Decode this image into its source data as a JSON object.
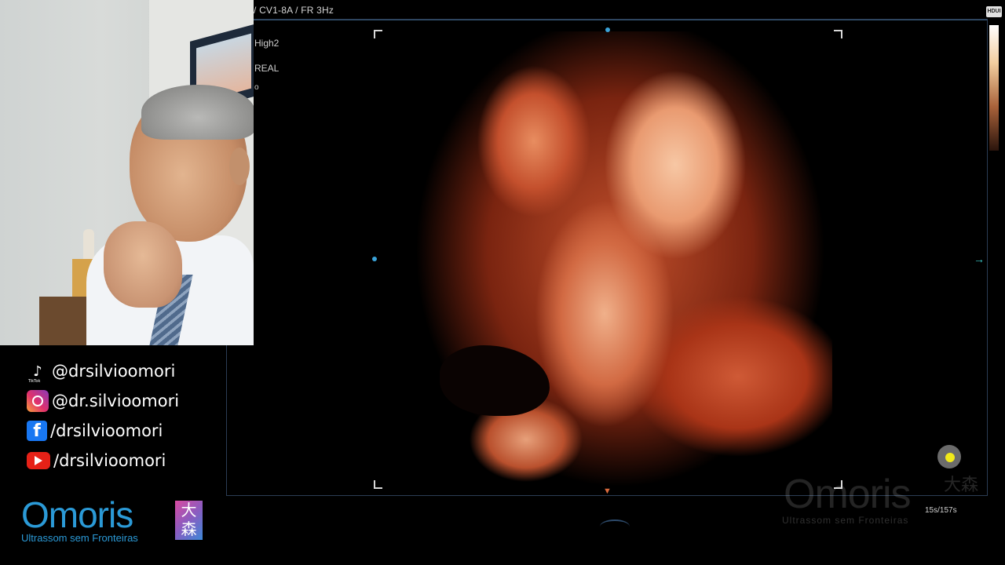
{
  "ultrasound": {
    "probe_info": "/ CV1-8A / FR 3Hz",
    "param_1": "High2",
    "param_2": "REAL",
    "param_3": "o",
    "badge": "HDUI",
    "timer": "15s/157s"
  },
  "watermark": {
    "logo": "Omoris",
    "tagline": "Ultrassom sem Fronteiras",
    "kanji": "大森"
  },
  "social": [
    {
      "platform": "TikTok",
      "icon": "tiktok-icon",
      "handle": "@drsilvioomori",
      "icon_caption": "TikTok"
    },
    {
      "platform": "Instagram",
      "icon": "instagram-icon",
      "handle": "@dr.silvioomori"
    },
    {
      "platform": "Facebook",
      "icon": "facebook-icon",
      "handle": "/drsilvioomori",
      "glyph": "f"
    },
    {
      "platform": "YouTube",
      "icon": "youtube-icon",
      "handle": "/drsilvioomori"
    }
  ],
  "brand": {
    "name": "Omoris",
    "tagline": "Ultrassom sem Fronteiras",
    "kanji_top": "大",
    "kanji_bottom": "森",
    "color": "#2b9ad7"
  },
  "colors": {
    "cursor": "#f2ea1a",
    "frame": "#2b3d55",
    "render": "#c2502c"
  }
}
